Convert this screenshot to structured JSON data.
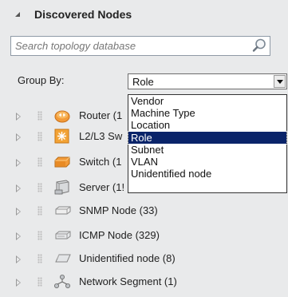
{
  "panel": {
    "title": "Discovered Nodes",
    "collapse_icon": "collapse-triangle-icon"
  },
  "search": {
    "placeholder": "Search topology database",
    "value": "",
    "icon": "search-icon"
  },
  "group_by": {
    "label": "Group By:",
    "selected": "Role",
    "options": [
      "Vendor",
      "Machine Type",
      "Location",
      "Role",
      "Subnet",
      "VLAN",
      "Unidentified node"
    ],
    "dropdown_open": true
  },
  "tree": {
    "items": [
      {
        "label": "Router (1",
        "icon": "router-icon"
      },
      {
        "label": "L2/L3 Sw",
        "icon": "l2l3-switch-icon"
      },
      {
        "label": "Switch (1",
        "icon": "switch-icon"
      },
      {
        "label": "Server (1!",
        "icon": "server-icon"
      },
      {
        "label": "SNMP Node (33)",
        "icon": "snmp-node-icon"
      },
      {
        "label": "ICMP Node (329)",
        "icon": "icmp-node-icon"
      },
      {
        "label": "Unidentified node (8)",
        "icon": "unidentified-node-icon"
      },
      {
        "label": "Network Segment (1)",
        "icon": "network-segment-icon"
      }
    ]
  },
  "colors": {
    "background": "#e9eaeb",
    "selection": "#0a246a",
    "router_orange": "#f29a38"
  }
}
